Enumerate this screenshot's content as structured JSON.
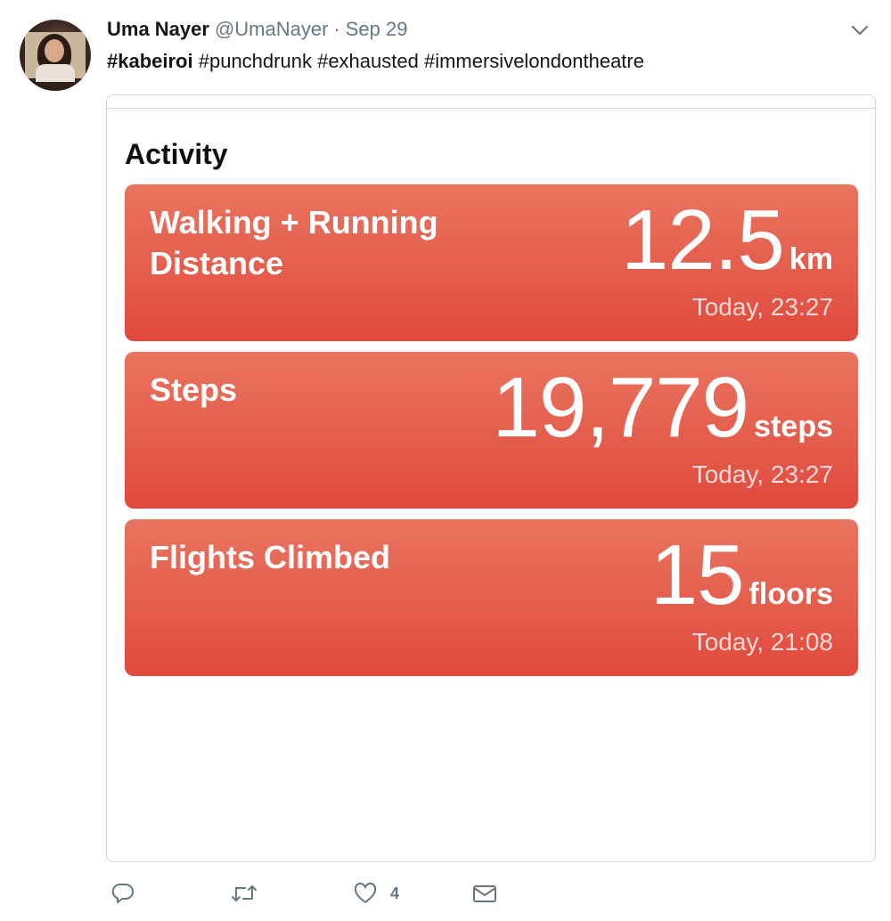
{
  "tweet": {
    "author_name": "Uma Nayer",
    "author_handle": "@UmaNayer",
    "separator": "·",
    "date": "Sep 29",
    "hashtags": [
      "#kabeiroi",
      "#punchdrunk",
      "#exhausted",
      "#immersivelondontheatre"
    ],
    "likes": "4"
  },
  "media": {
    "title": "Activity",
    "cards": [
      {
        "label_line1": "Walking + Running",
        "label_line2": "Distance",
        "value": "12.5",
        "unit": "km",
        "timestamp": "Today, 23:27"
      },
      {
        "label_line1": "Steps",
        "label_line2": "",
        "value": "19,779",
        "unit": "steps",
        "timestamp": "Today, 23:27"
      },
      {
        "label_line1": "Flights Climbed",
        "label_line2": "",
        "value": "15",
        "unit": "floors",
        "timestamp": "Today, 21:08"
      }
    ]
  },
  "icons": {
    "reply": "reply-icon",
    "retweet": "retweet-icon",
    "like": "heart-icon",
    "dm": "envelope-icon",
    "caret": "chevron-down-icon"
  },
  "colors": {
    "card_top": "#e97460",
    "card_bottom": "#e04a3d",
    "text_secondary": "#657786"
  }
}
